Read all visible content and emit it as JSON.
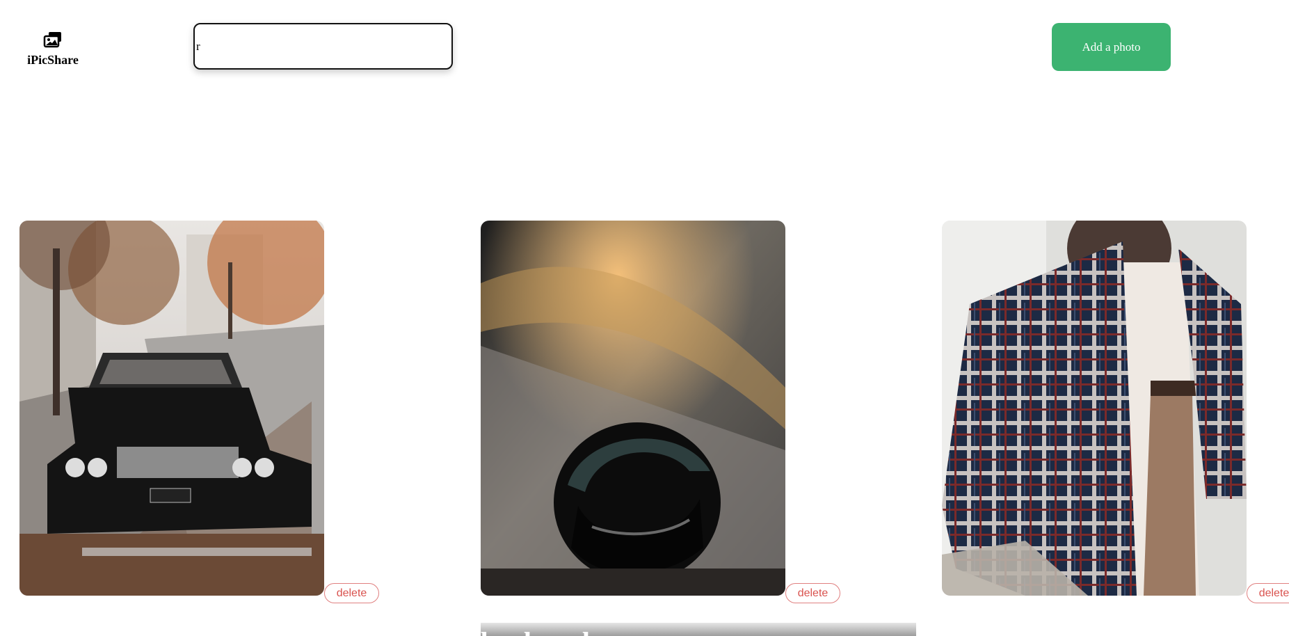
{
  "app": {
    "name": "iPicShare",
    "logo_icon": "photo-stack-icon"
  },
  "search": {
    "value": "r",
    "placeholder": ""
  },
  "toolbar": {
    "add_label": "Add a photo"
  },
  "photos": [
    {
      "subject": "vintage-car-autumn-street",
      "delete_label": "delete"
    },
    {
      "subject": "pilot-helmet-jet",
      "delete_label": "delete"
    },
    {
      "subject": "plaid-shirt-outfit",
      "delete_label": "delete"
    }
  ],
  "partial_card": {
    "caption": "boyboy dreew"
  },
  "colors": {
    "accent": "#3cb371",
    "delete": "#d9534f"
  }
}
